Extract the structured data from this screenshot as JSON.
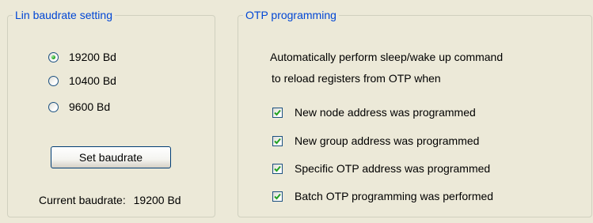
{
  "lin_baudrate": {
    "title": "Lin baudrate setting",
    "options": [
      {
        "label": "19200 Bd",
        "checked": true
      },
      {
        "label": "10400 Bd",
        "checked": false
      },
      {
        "label": "9600 Bd",
        "checked": false
      }
    ],
    "set_button_label": "Set baudrate",
    "current_label": "Current baudrate:",
    "current_value": "19200 Bd"
  },
  "otp_programming": {
    "title": "OTP programming",
    "description_line1": "Automatically perform sleep/wake up command",
    "description_line2": "to reload registers from OTP when",
    "checkboxes": [
      {
        "label": "New node address was programmed",
        "checked": true
      },
      {
        "label": "New group address was programmed",
        "checked": true
      },
      {
        "label": "Specific OTP address was programmed",
        "checked": true
      },
      {
        "label": "Batch OTP programming was performed",
        "checked": true
      }
    ]
  },
  "colors": {
    "window_bg": "#ece9d8",
    "groupbox_title": "#0046d5",
    "radio_dot": "#21a121",
    "checkmark": "#21a121"
  }
}
